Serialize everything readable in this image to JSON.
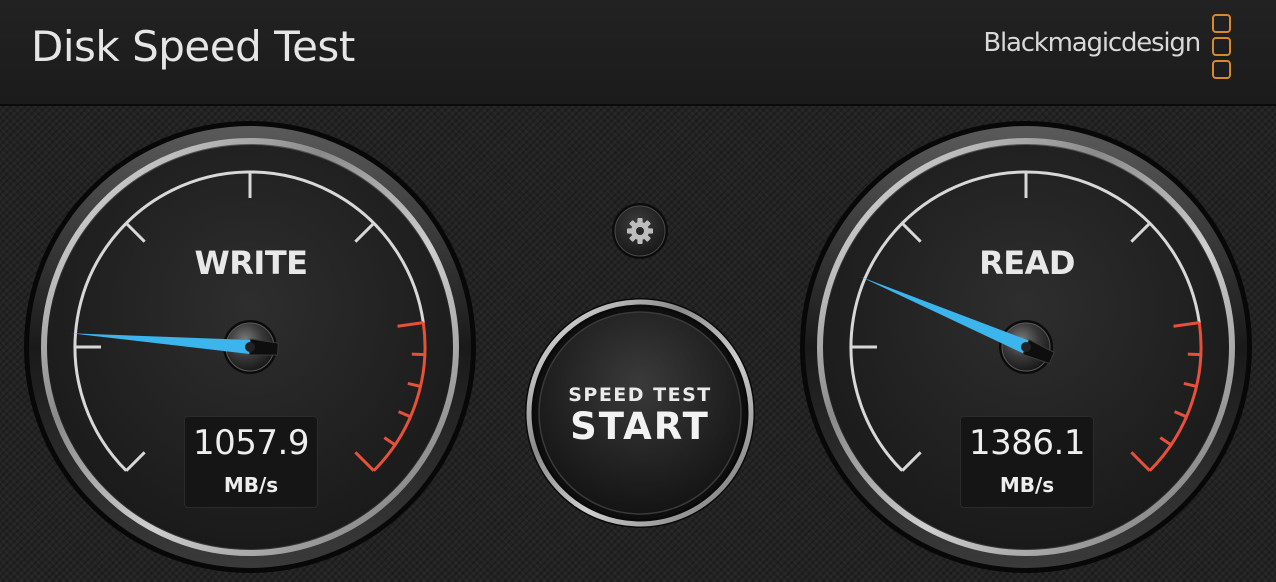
{
  "app": {
    "title": "Disk Speed Test",
    "brand": "Blackmagicdesign"
  },
  "controls": {
    "settings_icon": "gear-icon",
    "start": {
      "line1": "SPEED TEST",
      "line2": "START"
    }
  },
  "gauges": {
    "write": {
      "label": "WRITE",
      "value": "1057.9",
      "unit": "MB/s",
      "needle_color": "#3cb4ec"
    },
    "read": {
      "label": "READ",
      "value": "1386.1",
      "unit": "MB/s",
      "needle_color": "#3cb4ec"
    }
  },
  "colors": {
    "logo": "#d9882c",
    "redline": "#e8503a",
    "needle": "#3cb4ec"
  }
}
